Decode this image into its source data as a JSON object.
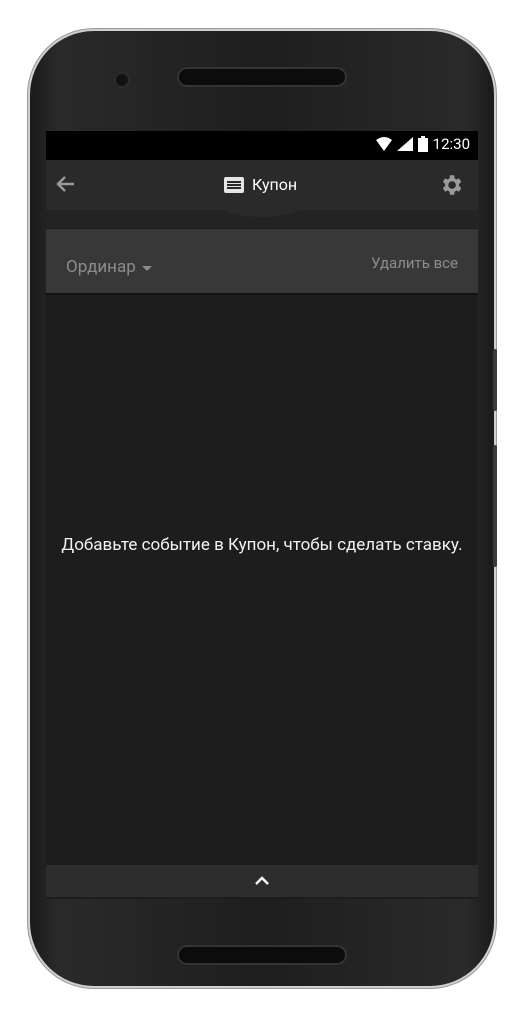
{
  "status_bar": {
    "time": "12:30"
  },
  "toolbar": {
    "title": "Купон"
  },
  "filter_bar": {
    "bet_type": "Ординар",
    "delete_all": "Удалить все"
  },
  "empty_state": {
    "message": "Добавьте событие в Купон, чтобы сделать ставку."
  }
}
